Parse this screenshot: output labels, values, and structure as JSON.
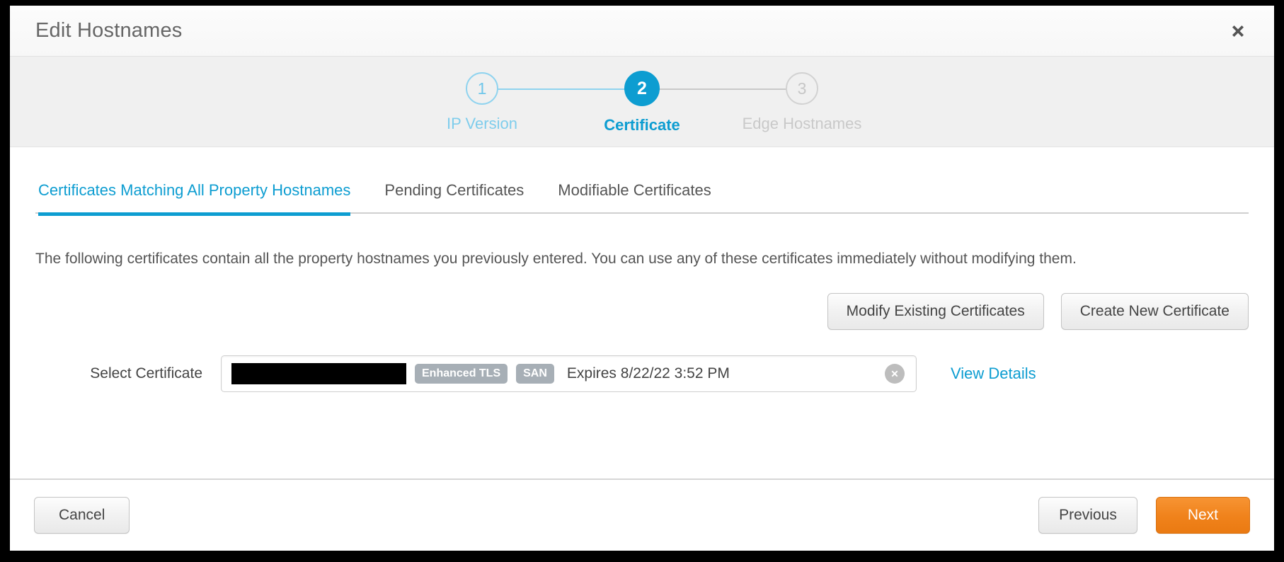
{
  "dialog": {
    "title": "Edit Hostnames",
    "close_icon": "close-icon"
  },
  "stepper": {
    "steps": [
      {
        "number": "1",
        "label": "IP Version",
        "state": "done"
      },
      {
        "number": "2",
        "label": "Certificate",
        "state": "current"
      },
      {
        "number": "3",
        "label": "Edge Hostnames",
        "state": "todo"
      }
    ],
    "active_color": "#0d9dd1",
    "done_color": "#8fd3ef",
    "todo_color": "#c9c9c9"
  },
  "tabs": [
    {
      "label": "Certificates Matching All Property Hostnames",
      "active": true
    },
    {
      "label": "Pending Certificates",
      "active": false
    },
    {
      "label": "Modifiable Certificates",
      "active": false
    }
  ],
  "main": {
    "description": "The following certificates contain all the property hostnames you previously entered. You can use any of these certificates immediately without modifying them.",
    "modify_existing_label": "Modify Existing Certificates",
    "create_new_label": "Create New Certificate",
    "select_label": "Select Certificate",
    "certificate": {
      "name_redacted": "",
      "badges": [
        "Enhanced TLS",
        "SAN"
      ],
      "expires": "Expires 8/22/22 3:52 PM",
      "clear_icon": "clear-circle-icon"
    },
    "view_details_label": "View Details"
  },
  "footer": {
    "cancel_label": "Cancel",
    "previous_label": "Previous",
    "next_label": "Next",
    "next_color": "#ef8220"
  }
}
